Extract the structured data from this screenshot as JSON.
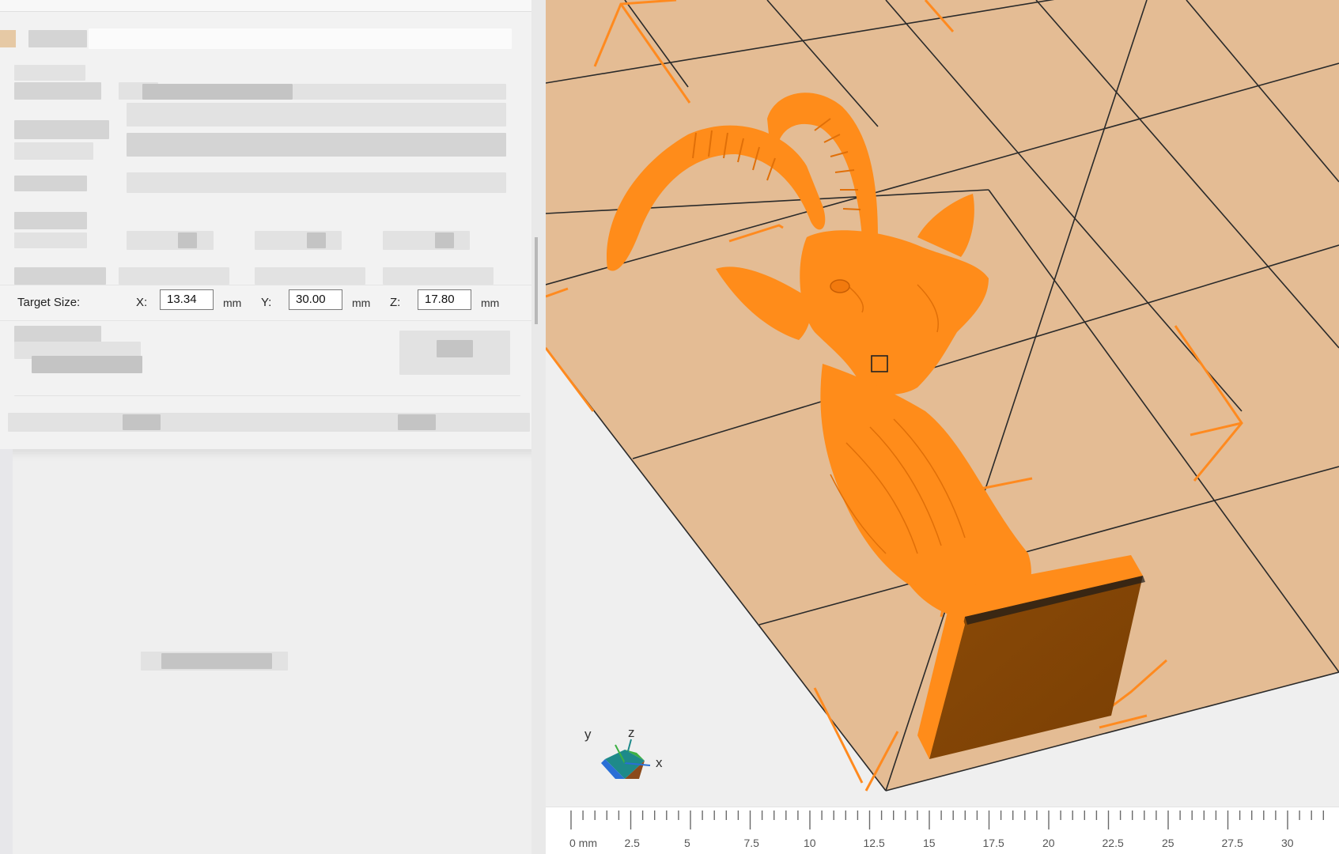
{
  "target_size": {
    "label": "Target Size:",
    "x_label": "X:",
    "x_value": "13.34",
    "y_label": "Y:",
    "y_value": "30.00",
    "z_label": "Z:",
    "z_value": "17.80",
    "unit": "mm"
  },
  "axes": {
    "x": "x",
    "y": "y",
    "z": "z"
  },
  "ruler": {
    "labels": [
      "0 mm",
      "2.5",
      "5",
      "7.5",
      "10",
      "12.5",
      "15",
      "17.5",
      "20",
      "22.5",
      "25",
      "27.5",
      "30"
    ]
  },
  "colors": {
    "model": "#ff8c1a",
    "plate": "#e4bc94",
    "grid_line": "#2a2a2a",
    "marker": "#ff8a1f",
    "panel_bg": "#efefef"
  },
  "icons": [
    "selection-box-icon",
    "orientation-gizmo-icon"
  ]
}
